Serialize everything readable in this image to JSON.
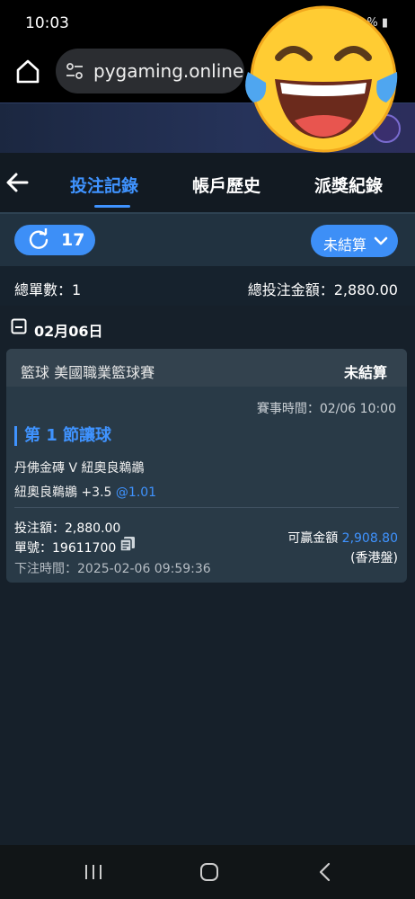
{
  "status_bar": {
    "time": "10:03",
    "icons_text": "▮ ◙ … % ▮"
  },
  "browser": {
    "url": "pygaming.online"
  },
  "nav": {
    "tabs": [
      {
        "label": "投注記錄"
      },
      {
        "label": "帳戶歷史"
      },
      {
        "label": "派獎紀錄"
      }
    ]
  },
  "filter": {
    "refresh_count": "17",
    "status_label": "未結算"
  },
  "summary": {
    "count_label": "總單數：1",
    "total_label": "總投注金額：2,880.00"
  },
  "date_header": "02月06日",
  "bet": {
    "league": "籃球 美國職業籃球賽",
    "status": "未結算",
    "match_time": "賽事時間：02/06 10:00",
    "market": "第 1 節讓球",
    "teams": "丹佛金磚 V 紐奧良鵜鶘",
    "selection": "紐奧良鵜鶘 +3.5 ",
    "odds": "@1.01",
    "stake": "投注額：2,880.00",
    "order_no": "單號：19611700",
    "bet_time": "下注時間：2025-02-06 09:59:36",
    "payout_label": "可贏金額 ",
    "payout_value": "2,908.80",
    "odds_type": "(香港盤)"
  },
  "colors": {
    "accent": "#3f93ff",
    "background": "#16202a",
    "card": "#293a47"
  }
}
